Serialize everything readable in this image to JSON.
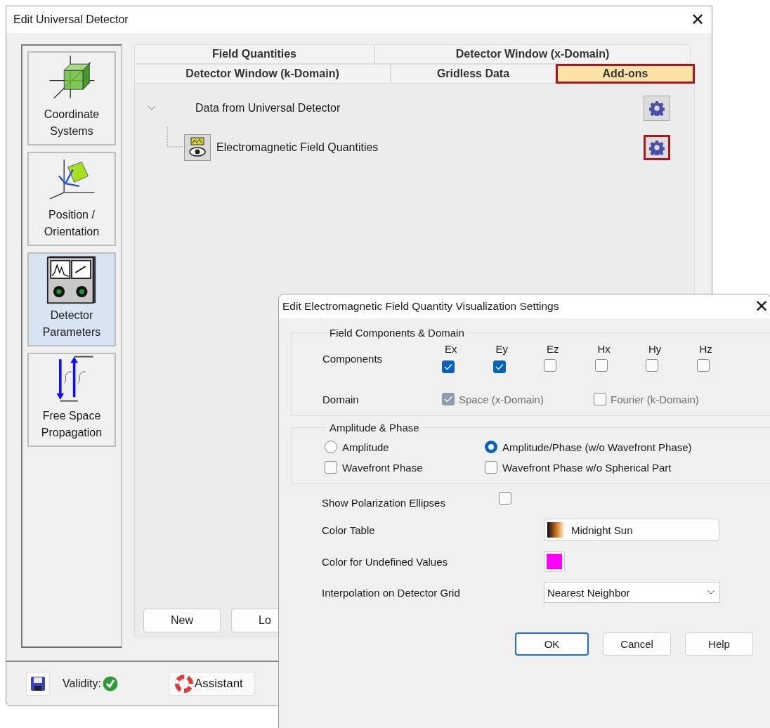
{
  "main_window": {
    "title": "Edit Universal Detector",
    "close": "✕",
    "sidebar": [
      {
        "label": "Coordinate Systems",
        "kind": "coordinates",
        "selected": false
      },
      {
        "label": "Position / Orientation",
        "kind": "position",
        "selected": false
      },
      {
        "label": "Detector Parameters",
        "kind": "detector",
        "selected": true
      },
      {
        "label": "Free Space Propagation",
        "kind": "propagation",
        "selected": false
      }
    ],
    "tab_rows": [
      [
        {
          "label": "Field Quantities",
          "selected": false,
          "highlighted": false
        },
        {
          "label": "Detector Window (x-Domain)",
          "selected": false,
          "highlighted": false
        }
      ],
      [
        {
          "label": "Detector Window (k-Domain)",
          "selected": false,
          "highlighted": false
        },
        {
          "label": "Gridless Data",
          "selected": false,
          "highlighted": false
        },
        {
          "label": "Add-ons",
          "selected": true,
          "highlighted": true
        }
      ]
    ],
    "tree": {
      "label": "Data from Universal Detector",
      "expanded": true,
      "highlighted": false,
      "children": [
        {
          "label": "Electromagnetic Field Quantities",
          "highlighted": true
        }
      ]
    },
    "buttons": [
      "New",
      "Lo"
    ],
    "footer": {
      "validity_label": "Validity:",
      "valid": true,
      "assistant": "Assistant"
    }
  },
  "dialog": {
    "title": "Edit Electromagnetic Field Quantity Visualization Settings",
    "close": "✕",
    "field_group": {
      "title": "Field Components & Domain",
      "components_label": "Components",
      "components": [
        {
          "label": "Ex",
          "checked": true
        },
        {
          "label": "Ey",
          "checked": true
        },
        {
          "label": "Ez",
          "checked": false
        },
        {
          "label": "Hx",
          "checked": false
        },
        {
          "label": "Hy",
          "checked": false
        },
        {
          "label": "Hz",
          "checked": false
        }
      ],
      "domain_label": "Domain",
      "domains": [
        {
          "label": "Space (x-Domain)",
          "checked": true,
          "disabled": true
        },
        {
          "label": "Fourier (k-Domain)",
          "checked": false,
          "disabled": true
        }
      ]
    },
    "amplitude_group": {
      "title": "Amplitude & Phase",
      "options": [
        {
          "kind": "radio",
          "label": "Amplitude",
          "selected": false
        },
        {
          "kind": "radio",
          "label": "Amplitude/Phase (w/o Wavefront Phase)",
          "selected": true
        },
        {
          "kind": "checkbox",
          "label": "Wavefront Phase",
          "checked": false
        },
        {
          "kind": "checkbox",
          "label": "Wavefront Phase w/o Spherical Part",
          "checked": false
        }
      ]
    },
    "show_ellipses": {
      "label": "Show Polarization Ellipses",
      "checked": false
    },
    "color_table": {
      "label": "Color Table",
      "value": "Midnight Sun"
    },
    "undefined_color": {
      "label": "Color for Undefined Values",
      "color": "#ff00ff"
    },
    "interpolation": {
      "label": "Interpolation on Detector Grid",
      "value": "Nearest Neighbor"
    },
    "buttons": [
      {
        "label": "OK",
        "default": true
      },
      {
        "label": "Cancel",
        "default": false
      },
      {
        "label": "Help",
        "default": false
      }
    ]
  }
}
